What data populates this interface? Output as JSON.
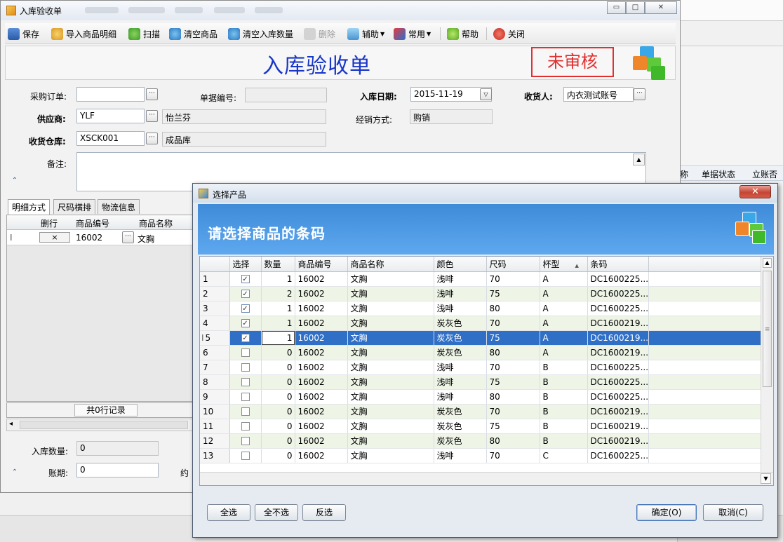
{
  "main_window": {
    "title": "入库验收单",
    "form_title": "入库验收单",
    "stamp": "未审核",
    "toolbar": {
      "save": "保存",
      "import_details": "导入商品明细",
      "scan": "扫描",
      "clear_products": "清空商品",
      "clear_quantity": "清空入库数量",
      "delete": "删除",
      "assist": "辅助",
      "common": "常用",
      "help": "帮助",
      "close": "关闭"
    },
    "form": {
      "purchase_order_label": "采购订单:",
      "purchase_order_value": "",
      "doc_number_label": "单据编号:",
      "doc_number_value": "",
      "entry_date_label": "入库日期:",
      "entry_date_value": "2015-11-19",
      "receiver_label": "收货人:",
      "receiver_value": "内衣测试账号",
      "supplier_label": "供应商:",
      "supplier_code": "YLF",
      "supplier_name": "怡兰芬",
      "operation_label": "经销方式:",
      "operation_value": "购销",
      "warehouse_label": "收货仓库:",
      "warehouse_code": "XSCK001",
      "warehouse_name": "成品库",
      "remark_label": "备注:"
    },
    "tabs": [
      "明细方式",
      "尺码横排",
      "物流信息"
    ],
    "detail_grid": {
      "headers": [
        "删行",
        "商品编号",
        "商品名称"
      ],
      "row": {
        "delete": "×",
        "code": "16002",
        "name": "文胸"
      }
    },
    "record_count": "共0行记录",
    "footer": {
      "qty_label": "入库数量:",
      "qty_value": "0",
      "term_label": "账期:",
      "term_value": "0",
      "partial_label": "约"
    }
  },
  "background_window": {
    "headers": [
      "单据状态",
      "立账否"
    ],
    "partial_header": "称"
  },
  "dialog": {
    "title": "选择产品",
    "header": "请选择商品的条码",
    "columns": [
      "选择",
      "数量",
      "商品编号",
      "商品名称",
      "颜色",
      "尺码",
      "杯型",
      "条码"
    ],
    "sort_indicator": "▲",
    "rows": [
      {
        "n": "1",
        "checked": true,
        "qty": "1",
        "code": "16002",
        "name": "文胸",
        "color": "浅啡",
        "size": "70",
        "cup": "A",
        "barcode": "DC1600225..."
      },
      {
        "n": "2",
        "checked": true,
        "qty": "2",
        "code": "16002",
        "name": "文胸",
        "color": "浅啡",
        "size": "75",
        "cup": "A",
        "barcode": "DC1600225..."
      },
      {
        "n": "3",
        "checked": true,
        "qty": "1",
        "code": "16002",
        "name": "文胸",
        "color": "浅啡",
        "size": "80",
        "cup": "A",
        "barcode": "DC1600225..."
      },
      {
        "n": "4",
        "checked": true,
        "qty": "1",
        "code": "16002",
        "name": "文胸",
        "color": "炭灰色",
        "size": "70",
        "cup": "A",
        "barcode": "DC1600219..."
      },
      {
        "n": "5",
        "checked": true,
        "qty": "1",
        "code": "16002",
        "name": "文胸",
        "color": "炭灰色",
        "size": "75",
        "cup": "A",
        "barcode": "DC1600219...",
        "selected": true
      },
      {
        "n": "6",
        "checked": false,
        "qty": "0",
        "code": "16002",
        "name": "文胸",
        "color": "炭灰色",
        "size": "80",
        "cup": "A",
        "barcode": "DC1600219..."
      },
      {
        "n": "7",
        "checked": false,
        "qty": "0",
        "code": "16002",
        "name": "文胸",
        "color": "浅啡",
        "size": "70",
        "cup": "B",
        "barcode": "DC1600225..."
      },
      {
        "n": "8",
        "checked": false,
        "qty": "0",
        "code": "16002",
        "name": "文胸",
        "color": "浅啡",
        "size": "75",
        "cup": "B",
        "barcode": "DC1600225..."
      },
      {
        "n": "9",
        "checked": false,
        "qty": "0",
        "code": "16002",
        "name": "文胸",
        "color": "浅啡",
        "size": "80",
        "cup": "B",
        "barcode": "DC1600225..."
      },
      {
        "n": "10",
        "checked": false,
        "qty": "0",
        "code": "16002",
        "name": "文胸",
        "color": "炭灰色",
        "size": "70",
        "cup": "B",
        "barcode": "DC1600219..."
      },
      {
        "n": "11",
        "checked": false,
        "qty": "0",
        "code": "16002",
        "name": "文胸",
        "color": "炭灰色",
        "size": "75",
        "cup": "B",
        "barcode": "DC1600219..."
      },
      {
        "n": "12",
        "checked": false,
        "qty": "0",
        "code": "16002",
        "name": "文胸",
        "color": "炭灰色",
        "size": "80",
        "cup": "B",
        "barcode": "DC1600219..."
      },
      {
        "n": "13",
        "checked": false,
        "qty": "0",
        "code": "16002",
        "name": "文胸",
        "color": "浅啡",
        "size": "70",
        "cup": "C",
        "barcode": "DC1600225..."
      }
    ],
    "buttons": {
      "select_all": "全选",
      "select_none": "全不选",
      "invert": "反选",
      "ok": "确定(O)",
      "cancel": "取消(C)"
    }
  },
  "colors": {
    "form_title": "#1836c8",
    "stamp": "#e23030",
    "dialog_header": "#4f9ae6",
    "selected_row": "#2f6fc6",
    "alt_row": "#eef4e6"
  }
}
